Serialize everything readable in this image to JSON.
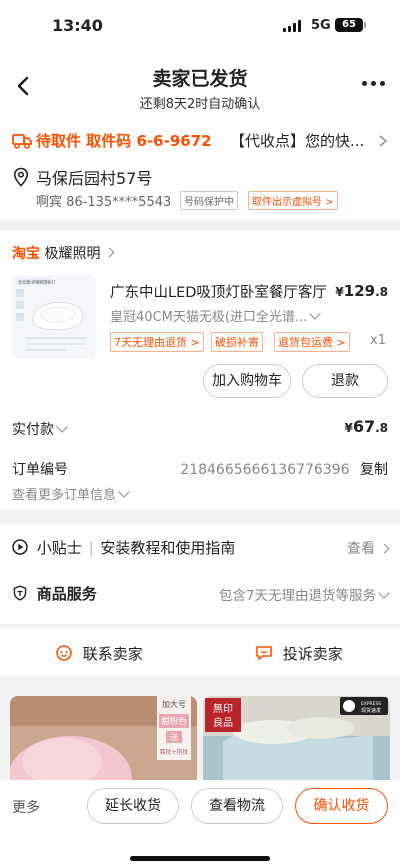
{
  "status_bar": {
    "time": "13:40",
    "network": "5G",
    "battery": "65"
  },
  "header": {
    "title": "卖家已发货",
    "subtitle": "还剩8天2时自动确认"
  },
  "pickup": {
    "status": "待取件",
    "code_label": "取件码",
    "code": "6-6-9672",
    "tail": "【代收点】您的快..."
  },
  "address": {
    "name": "马保后园村57号",
    "contact": "啊宾 86-135****5543",
    "protect_tag": "号码保护中",
    "virtual_tag": "取件出示虚拟号 >"
  },
  "shop": {
    "platform": "淘宝",
    "name": "极耀照明"
  },
  "product": {
    "title": "广东中山LED吸顶灯卧室餐厅客厅",
    "price_symbol": "¥",
    "price_int": "129",
    "price_dec": ".8",
    "spec": "皇冠40CM天猫无极(进口全光谱...",
    "tags": [
      "7天无理由退货 >",
      "破损补寄",
      "退货包运费 >"
    ],
    "qty": "x1",
    "img_caption_1": "全光谱·护眼新国标灯",
    "add_cart": "加入购物车",
    "refund": "退款"
  },
  "payment": {
    "label": "实付款",
    "symbol": "¥",
    "int": "67",
    "dec": ".8"
  },
  "order": {
    "label": "订单编号",
    "number": "2184665666136776396",
    "copy": "复制",
    "more": "查看更多订单信息"
  },
  "tips": {
    "label": "小贴士",
    "text": "安装教程和使用指南",
    "action": "查看"
  },
  "service": {
    "label": "商品服务",
    "text": "包含7天无理由退货等服务"
  },
  "contact": {
    "seller": "联系卖家",
    "complain": "投诉卖家"
  },
  "recommend": {
    "left": {
      "badge_1": "加大号",
      "badge_2": "甜粉色",
      "badge_3": "送",
      "badge_4": "靠枕+抱枕"
    },
    "right": {
      "brand_1": "無印",
      "brand_2": "良品",
      "express": "EXPRESS",
      "express_sub": "现货速发"
    }
  },
  "bottom_bar": {
    "more": "更多",
    "extend": "延长收货",
    "logistics": "查看物流",
    "confirm": "确认收货"
  },
  "colors": {
    "accent": "#ff5000",
    "text": "#222222",
    "muted": "#888888"
  }
}
